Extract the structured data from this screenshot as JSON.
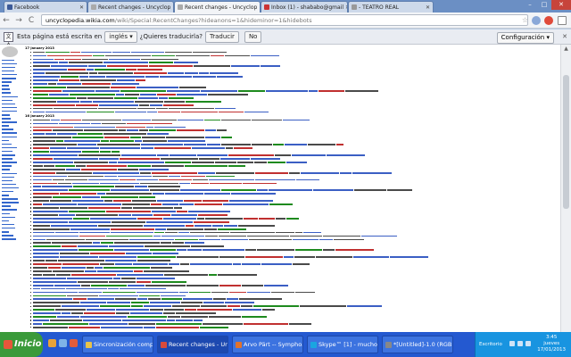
{
  "tabs": [
    {
      "title": "Facebook",
      "favicon_color": "#3b5998"
    },
    {
      "title": "Recent changes - Uncyclop",
      "favicon_color": "#aaaaaa"
    },
    {
      "title": "Recent changes - Uncyclop",
      "favicon_color": "#aaaaaa"
    },
    {
      "title": "Inbox (1) - shababo@gmail",
      "favicon_color": "#cc3333"
    },
    {
      "title": "- TEATRO REAL",
      "favicon_color": "#999999"
    }
  ],
  "window_buttons": {
    "minimize": "–",
    "maximize": "□",
    "close": "✕"
  },
  "address": {
    "domain": "uncyclopedia.wikia.com",
    "path": "/wiki/Special:RecentChanges?hideanons=1&hideminor=1&hidebots"
  },
  "nav": {
    "back": "←",
    "forward": "→",
    "reload": "C"
  },
  "translate": {
    "message": "Esta página está escrita en",
    "language": "inglés",
    "question": "¿Quieres traducirla?",
    "translate_button": "Traducir",
    "no_button": "No",
    "settings_button": "Configuración",
    "close": "✕"
  },
  "content": {
    "date_headers": [
      "17 January 2013",
      "16 January 2013"
    ]
  },
  "taskbar": {
    "start_label": "Inicio",
    "tasks": [
      {
        "label": "Sincronización comple...",
        "icon_color": "#e8c24a"
      },
      {
        "label": "Recent changes - Un...",
        "icon_color": "#d94b3b"
      },
      {
        "label": "Arvo Pärt -- Sympho...",
        "icon_color": "#e0722c"
      },
      {
        "label": "Skype™ [1] - muchot...",
        "icon_color": "#1aa5e0"
      },
      {
        "label": "*[Untitled]-1.0 (RGB ...",
        "icon_color": "#888888"
      }
    ],
    "tray": {
      "desktop_label": "Escritorio",
      "time": "3:45",
      "day": "jueves",
      "date": "17/01/2013"
    }
  }
}
